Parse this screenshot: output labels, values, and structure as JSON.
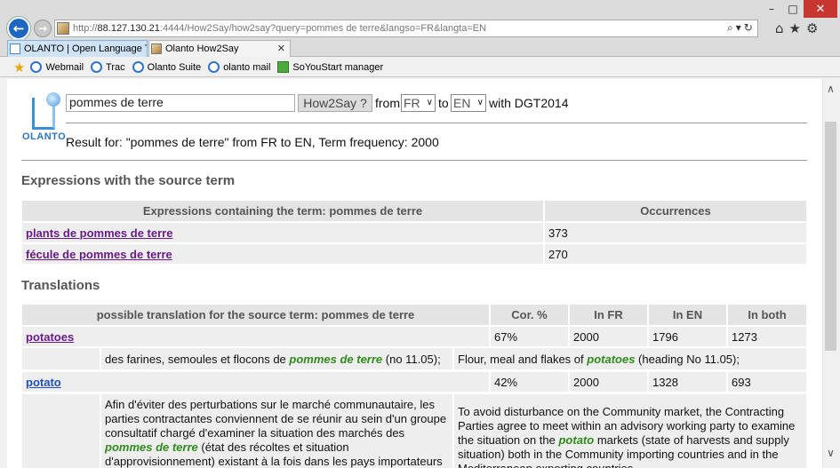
{
  "browser": {
    "url_prefix": "http://",
    "url_host": "88.127.130.21",
    "url_rest": ":4444/How2Say/how2say?query=pommes de terre&langso=FR&langta=EN",
    "tabs": [
      {
        "label": "OLANTO | Open Language Too..."
      },
      {
        "label": "Olanto How2Say"
      }
    ],
    "favorites": [
      "Webmail",
      "Trac",
      "Olanto Suite",
      "olanto mail",
      "SoYouStart manager"
    ]
  },
  "header": {
    "logo_text": "OLANTO",
    "query_value": "pommes de terre",
    "button_label": "How2Say ?",
    "from_label": "from",
    "from_lang": "FR",
    "to_label": "to",
    "to_lang": "EN",
    "with_label": "with DGT2014",
    "result_text": "Result for: \"pommes de terre\" from FR to EN, Term frequency: 2000"
  },
  "expressions": {
    "title": "Expressions with the source term",
    "col_expr": "Expressions containing the term: pommes de terre",
    "col_occ": "Occurrences",
    "rows": [
      {
        "term": "plants de pommes de terre",
        "occ": "373"
      },
      {
        "term": "fécule de pommes de terre",
        "occ": "270"
      }
    ]
  },
  "translations": {
    "title": "Translations",
    "cols": [
      "possible translation for the source term: pommes de terre",
      "Cor. %",
      "In FR",
      "In EN",
      "In both"
    ],
    "rows": [
      {
        "term": "potatoes",
        "cor": "67%",
        "fr": "2000",
        "en": "1796",
        "both": "1273",
        "ctx_fr_pre": "des farines, semoules et flocons de ",
        "ctx_fr_hl": "pommes de terre",
        "ctx_fr_post": " (no 11.05);",
        "ctx_en_pre": "Flour, meal and flakes of ",
        "ctx_en_hl": "potatoes",
        "ctx_en_post": " (heading No 11.05);"
      },
      {
        "term": "potato",
        "cor": "42%",
        "fr": "2000",
        "en": "1328",
        "both": "693",
        "ctx_fr_pre": "Afin d'éviter des perturbations sur le marché communautaire, les parties contractantes conviennent de se réunir au sein d'un groupe consultatif chargé d'examiner la situation des marchés des ",
        "ctx_fr_hl": "pommes de terre",
        "ctx_fr_post": " (état des récoltes et situation d'approvisionnement) existant à la fois dans les pays importateurs communautaires et dans les",
        "ctx_en_pre": "To avoid disturbance on the Community market, the Contracting Parties agree to meet within an advisory working party to examine the situation on the ",
        "ctx_en_hl": "potato",
        "ctx_en_post": " markets (state of harvests and supply situation) both in the Community importing countries and in the Mediterranean exporting countries"
      }
    ]
  }
}
